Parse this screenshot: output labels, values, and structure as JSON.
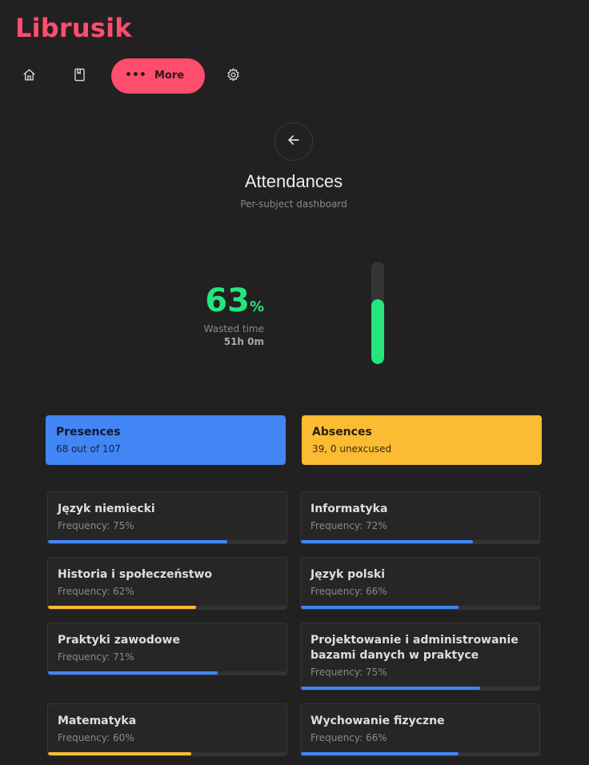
{
  "app": {
    "title": "Librusik"
  },
  "nav": {
    "home_icon": "home-icon",
    "book_icon": "book-icon",
    "more_icon": "more-dots-icon",
    "more_dots": "•••",
    "more_label": "More",
    "settings_icon": "gear-icon"
  },
  "page": {
    "back_icon": "arrow-left-icon",
    "title": "Attendances",
    "subtitle": "Per-subject dashboard"
  },
  "stats": {
    "percent": "63",
    "percent_unit": "%",
    "percent_value": 63,
    "wasted_label": "Wasted time",
    "wasted_value": "51h 0m"
  },
  "summary": {
    "presences": {
      "title": "Presences",
      "detail": "68 out of 107"
    },
    "absences": {
      "title": "Absences",
      "detail": "39, 0 unexcused"
    }
  },
  "subjects": [
    {
      "name": "Język niemiecki",
      "frequency": "Frequency: 75%",
      "value": 75,
      "color": "blue"
    },
    {
      "name": "Informatyka",
      "frequency": "Frequency: 72%",
      "value": 72,
      "color": "blue"
    },
    {
      "name": "Historia i społeczeństwo",
      "frequency": "Frequency: 62%",
      "value": 62,
      "color": "yellow"
    },
    {
      "name": "Język polski",
      "frequency": "Frequency: 66%",
      "value": 66,
      "color": "blue"
    },
    {
      "name": "Praktyki zawodowe",
      "frequency": "Frequency: 71%",
      "value": 71,
      "color": "blue"
    },
    {
      "name": "Projektowanie i administrowanie bazami danych w praktyce",
      "frequency": "Frequency: 75%",
      "value": 75,
      "color": "blue"
    },
    {
      "name": "Matematyka",
      "frequency": "Frequency: 60%",
      "value": 60,
      "color": "yellow"
    },
    {
      "name": "Wychowanie fizyczne",
      "frequency": "Frequency: 66%",
      "value": 66,
      "color": "blue"
    }
  ],
  "colors": {
    "accent": "#ff4d6d",
    "green": "#26e57d",
    "blue": "#4285f4",
    "yellow": "#fbbb33",
    "background": "#212121"
  }
}
